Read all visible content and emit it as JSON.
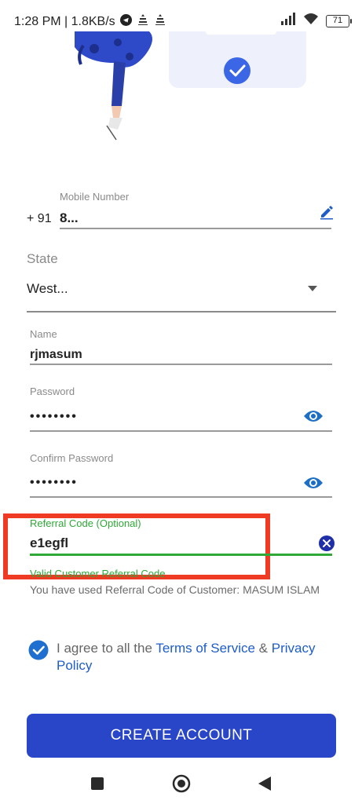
{
  "status_bar": {
    "time_speed": "1:28 PM | 1.8KB/s",
    "battery": "71"
  },
  "form": {
    "mobile": {
      "label": "Mobile Number",
      "country_code": "+ 91",
      "value": "8..."
    },
    "state": {
      "label": "State",
      "value": "West..."
    },
    "name": {
      "label": "Name",
      "value": "rjmasum"
    },
    "password": {
      "label": "Password",
      "value": "••••••••"
    },
    "confirm_password": {
      "label": "Confirm Password",
      "value": "••••••••"
    },
    "referral": {
      "label": "Referral Code (Optional)",
      "value": "e1egfl",
      "valid_text": "Valid Customer Referral Code",
      "note": "You have used Referral Code of Customer: MASUM ISLAM"
    },
    "agree": {
      "prefix": "I agree to all the ",
      "terms": "Terms of Service",
      "and": " & ",
      "privacy": "Privacy Policy",
      "checked": true
    },
    "create_button": "CREATE ACCOUNT"
  },
  "colors": {
    "primary": "#2a46c8",
    "link": "#1e5cc8",
    "valid_green": "#2fa837",
    "highlight_red": "#ef3b24",
    "eye_icon": "#1c6fc4"
  }
}
